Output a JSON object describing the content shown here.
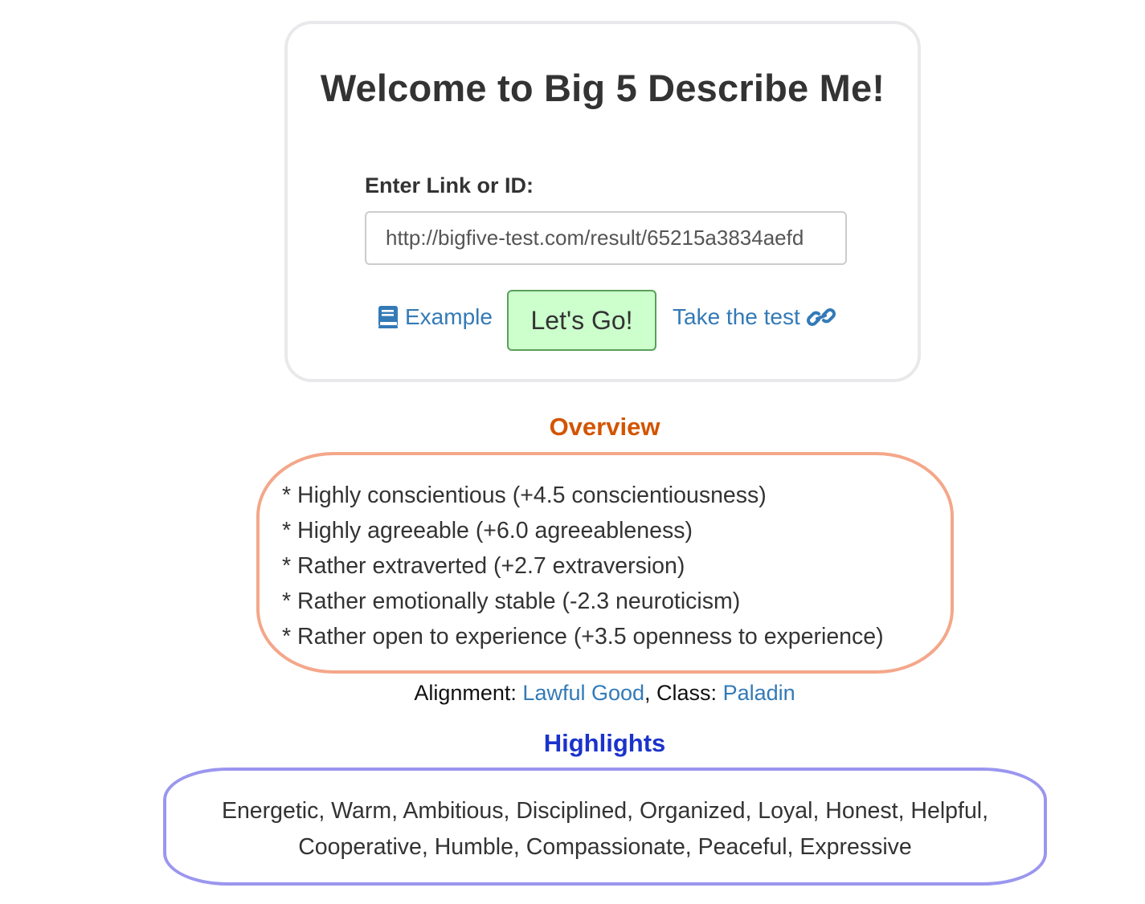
{
  "header": {
    "title": "Welcome to Big 5 Describe Me!"
  },
  "form": {
    "label": "Enter Link or ID:",
    "input_value": "http://bigfive-test.com/result/65215a3834aefd"
  },
  "actions": {
    "example_label": "Example",
    "example_icon": "book-icon",
    "go_label": "Let's Go!",
    "take_test_label": "Take the test",
    "take_test_icon": "link-icon"
  },
  "overview": {
    "heading": "Overview",
    "items": [
      "* Highly conscientious (+4.5 conscientiousness)",
      "* Highly agreeable (+6.0 agreeableness)",
      "* Rather extraverted (+2.7 extraversion)",
      "* Rather emotionally stable (-2.3 neuroticism)",
      "* Rather open to experience (+3.5 openness to experience)"
    ]
  },
  "classification": {
    "alignment_label": "Alignment: ",
    "alignment_value": "Lawful Good",
    "separator": ", Class: ",
    "class_value": "Paladin"
  },
  "highlights": {
    "heading": "Highlights",
    "text": "Energetic, Warm, Ambitious, Disciplined, Organized, Loyal, Honest, Helpful, Cooperative, Humble, Compassionate, Peaceful, Expressive"
  },
  "colors": {
    "link": "#337ab7",
    "overview_heading": "#d35400",
    "overview_border": "#f4a78a",
    "highlights_heading": "#1a33cc",
    "highlights_border": "#9b96ef",
    "go_button_bg": "#ccffcc"
  }
}
